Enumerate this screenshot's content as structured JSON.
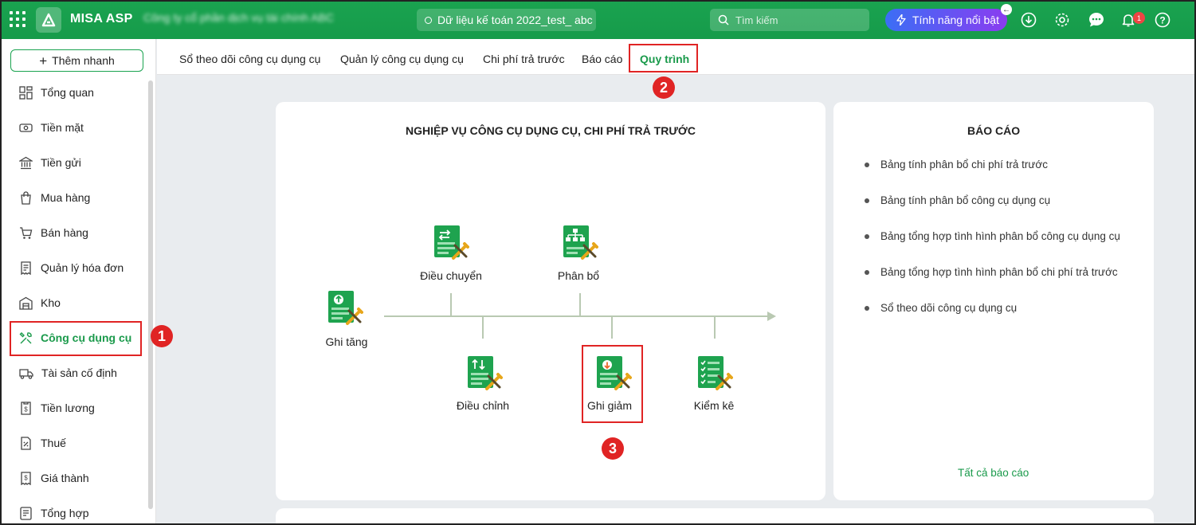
{
  "header": {
    "brand": "MISA ASP",
    "company_name": "Công ty cổ phần dịch vụ tài chính ABC",
    "dataset": "Dữ liệu kế toán 2022_test_ abc",
    "search_placeholder": "Tìm kiếm",
    "feature_label": "Tính năng nổi bật",
    "notification_count": "1"
  },
  "sidebar": {
    "quick_add": "Thêm nhanh",
    "items": [
      {
        "label": "Tổng quan",
        "icon": "dashboard-icon"
      },
      {
        "label": "Tiền mặt",
        "icon": "cash-icon"
      },
      {
        "label": "Tiền gửi",
        "icon": "bank-icon"
      },
      {
        "label": "Mua hàng",
        "icon": "shopping-bag-icon"
      },
      {
        "label": "Bán hàng",
        "icon": "cart-icon"
      },
      {
        "label": "Quản lý hóa đơn",
        "icon": "invoice-icon"
      },
      {
        "label": "Kho",
        "icon": "warehouse-icon"
      },
      {
        "label": "Công cụ dụng cụ",
        "icon": "tools-icon",
        "active": true
      },
      {
        "label": "Tài sản cố định",
        "icon": "truck-icon"
      },
      {
        "label": "Tiền lương",
        "icon": "payroll-icon"
      },
      {
        "label": "Thuế",
        "icon": "tax-icon"
      },
      {
        "label": "Giá thành",
        "icon": "cost-icon"
      },
      {
        "label": "Tổng hợp",
        "icon": "summary-icon"
      }
    ]
  },
  "tabs": [
    {
      "label": "Sổ theo dõi công cụ dụng cụ"
    },
    {
      "label": "Quản lý công cụ dụng cụ"
    },
    {
      "label": "Chi phí trả trước"
    },
    {
      "label": "Báo cáo"
    },
    {
      "label": "Quy trình",
      "active": true
    }
  ],
  "workflow": {
    "title": "NGHIỆP VỤ CÔNG CỤ DỤNG CỤ, CHI PHÍ TRẢ TRƯỚC",
    "nodes": {
      "ghi_tang": "Ghi tăng",
      "dieu_chuyen": "Điều chuyển",
      "phan_bo": "Phân bổ",
      "dieu_chinh": "Điều chỉnh",
      "ghi_giam": "Ghi giảm",
      "kiem_ke": "Kiểm kê"
    }
  },
  "reports": {
    "title": "BÁO CÁO",
    "items": [
      "Bảng tính phân bổ chi phí trả trước",
      "Bảng tính phân bổ công cụ dụng cụ",
      "Bảng tổng hợp tình hình phân bổ công cụ dụng cụ",
      "Bảng tổng hợp tình hình phân bổ chi phí trả trước",
      "Sổ theo dõi công cụ dụng cụ"
    ],
    "all_link": "Tất cả báo cáo"
  },
  "annotations": {
    "step1": "1",
    "step2": "2",
    "step3": "3"
  },
  "colors": {
    "brand_green": "#1aa350",
    "active_text": "#1a9a4b",
    "highlight_red": "#e02424",
    "feature_gradient_start": "#3b6ef5",
    "feature_gradient_end": "#8b3cf0"
  }
}
